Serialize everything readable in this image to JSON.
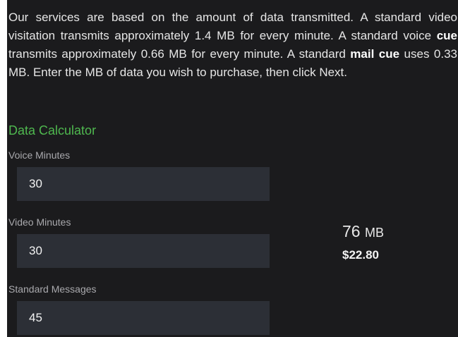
{
  "intro": {
    "part1": "Our services are based on the amount of data transmitted. A standard video visitation transmits approximately 1.4 MB for every minute. A standard voice ",
    "voice_term": "cue",
    "part2": " transmits approximately 0.66 MB for every minute. A standard ",
    "mail_term": "mail cue",
    "part3": " uses 0.33 MB. Enter the MB of data you wish to purchase, then click Next."
  },
  "calculator": {
    "title": "Data Calculator",
    "fields": [
      {
        "label": "Voice Minutes",
        "value": "30"
      },
      {
        "label": "Video Minutes",
        "value": "30"
      },
      {
        "label": "Standard Messages",
        "value": "45"
      }
    ],
    "result": {
      "amount": "76",
      "unit": "MB",
      "price": "$22.80"
    }
  },
  "colors": {
    "background": "#1b1b1d",
    "input_background": "#2c2f36",
    "accent_green": "#4fb84f"
  }
}
